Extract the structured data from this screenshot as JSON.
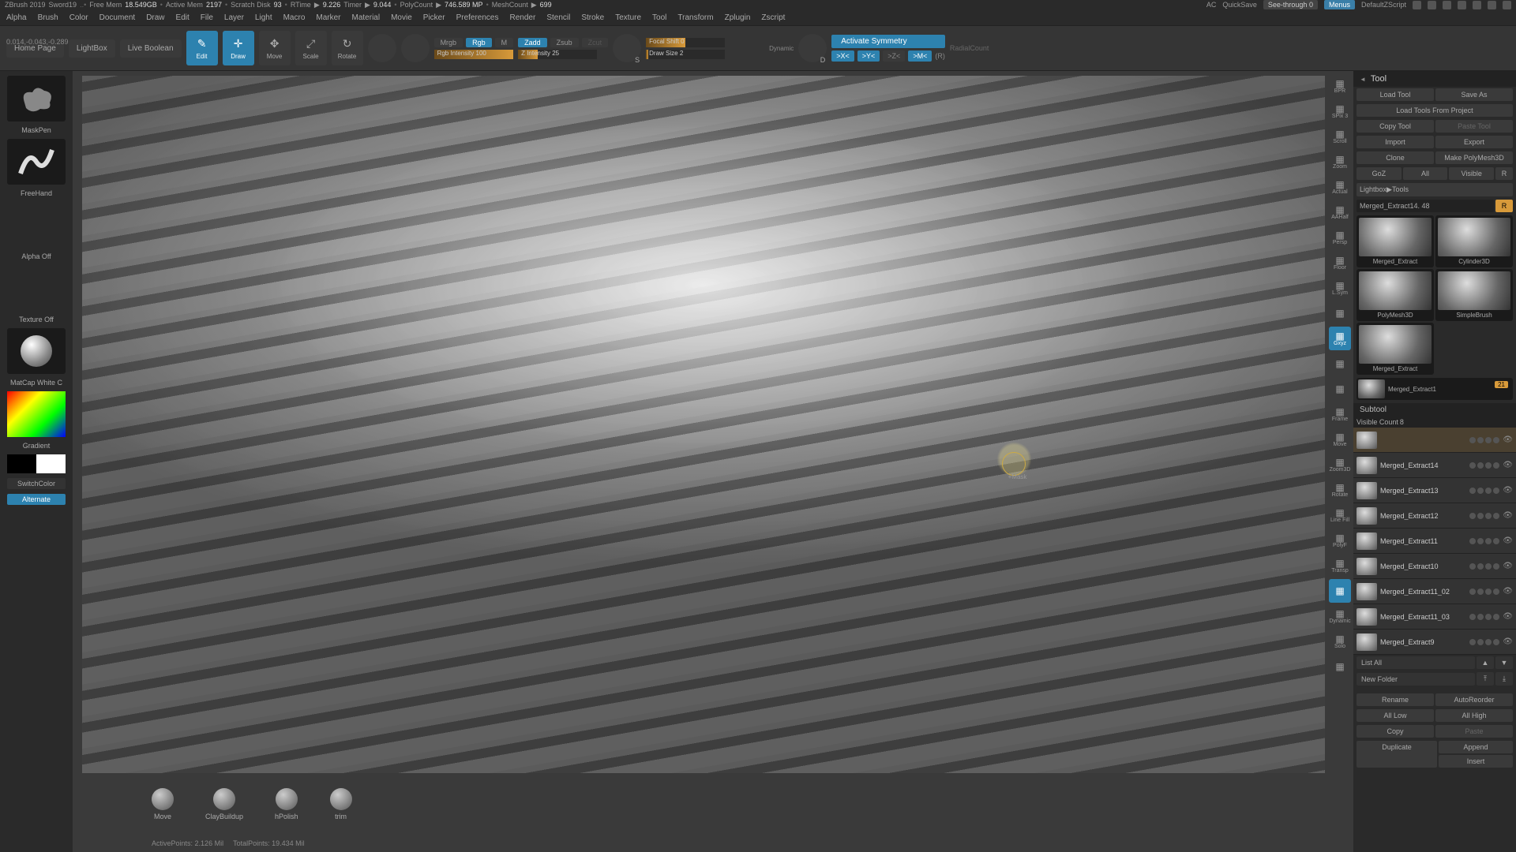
{
  "titlebar": {
    "app": "ZBrush 2019",
    "file": "Sword19",
    "freemem_label": "Free Mem",
    "freemem": "18.549GB",
    "activemem_label": "Active Mem",
    "activemem": "2197",
    "scratch_label": "Scratch Disk",
    "scratch": "93",
    "rtime_label": "RTime",
    "rtime": "9.226",
    "timer_label": "Timer",
    "timer": "9.044",
    "polycount_label": "PolyCount",
    "polycount": "746.589 MP",
    "meshcount_label": "MeshCount",
    "meshcount": "699",
    "ac": "AC",
    "quicksave": "QuickSave",
    "seethrough_label": "See-through",
    "seethrough": "0",
    "menus": "Menus",
    "zscript": "DefaultZScript"
  },
  "menubar": [
    "Alpha",
    "Brush",
    "Color",
    "Document",
    "Draw",
    "Edit",
    "File",
    "Layer",
    "Light",
    "Macro",
    "Marker",
    "Material",
    "Movie",
    "Picker",
    "Preferences",
    "Render",
    "Stencil",
    "Stroke",
    "Texture",
    "Tool",
    "Transform",
    "Zplugin",
    "Zscript"
  ],
  "coords": "0.014,-0.043,-0.289",
  "toolbar": {
    "home": "Home Page",
    "lightbox": "LightBox",
    "liveboolean": "Live Boolean",
    "edit": "Edit",
    "draw": "Draw",
    "move": "Move",
    "scale": "Scale",
    "rotate": "Rotate",
    "mrgb": "Mrgb",
    "rgb": "Rgb",
    "m": "M",
    "rgbintensity_label": "Rgb Intensity",
    "rgbintensity": "100",
    "zadd": "Zadd",
    "zsub": "Zsub",
    "zcut": "Zcut",
    "zintensity_label": "Z Intensity",
    "zintensity": "25",
    "focalshift_label": "Focal Shift",
    "focalshift": "0",
    "drawsize_label": "Draw Size",
    "drawsize": "2",
    "dynamic": "Dynamic",
    "s": "S",
    "d": "D",
    "activate_symmetry": "Activate Symmetry",
    "radialcount": "RadialCount",
    "sym_x": ">X<",
    "sym_y": ">Y<",
    "sym_z": ">Z<",
    "sym_m": ">M<",
    "sym_r": "(R)"
  },
  "left": {
    "maskpen": "MaskPen",
    "freehand": "FreeHand",
    "alphaoff": "Alpha Off",
    "textureoff": "Texture Off",
    "matcap": "MatCap White C",
    "gradient": "Gradient",
    "switchcolor": "SwitchColor",
    "alternate": "Alternate"
  },
  "rightstrip": [
    {
      "l": "BPR",
      "a": false
    },
    {
      "l": "SPix 3",
      "a": false
    },
    {
      "l": "Scroll",
      "a": false
    },
    {
      "l": "Zoom",
      "a": false
    },
    {
      "l": "Actual",
      "a": false
    },
    {
      "l": "AAHalf",
      "a": false
    },
    {
      "l": "Persp",
      "a": false
    },
    {
      "l": "Floor",
      "a": false
    },
    {
      "l": "L.Sym",
      "a": false
    },
    {
      "l": "",
      "a": false
    },
    {
      "l": "Gxyz",
      "a": true
    },
    {
      "l": "",
      "a": false
    },
    {
      "l": "",
      "a": false
    },
    {
      "l": "Frame",
      "a": false
    },
    {
      "l": "Move",
      "a": false
    },
    {
      "l": "Zoom3D",
      "a": false
    },
    {
      "l": "Rotate",
      "a": false
    },
    {
      "l": "Line Fill",
      "a": false
    },
    {
      "l": "PolyF",
      "a": false
    },
    {
      "l": "Transp",
      "a": false
    },
    {
      "l": "",
      "a": true
    },
    {
      "l": "Dynamic",
      "a": false
    },
    {
      "l": "Solo",
      "a": false
    },
    {
      "l": "",
      "a": false
    }
  ],
  "bottom": [
    "Move",
    "ClayBuildup",
    "hPolish",
    "trim"
  ],
  "stats": {
    "active_label": "ActivePoints:",
    "active": "2.126 Mil",
    "total_label": "TotalPoints:",
    "total": "19.434 Mil"
  },
  "cursor_label": "+Mask",
  "tool": {
    "header": "Tool",
    "row1": [
      "Load Tool",
      "Save As"
    ],
    "row2": "Load Tools From Project",
    "row3": [
      "Copy Tool",
      "Paste Tool"
    ],
    "row4": [
      "Import",
      "Export"
    ],
    "row5": [
      "Clone",
      "Make PolyMesh3D"
    ],
    "row6": [
      "GoZ",
      "All",
      "Visible",
      "R"
    ],
    "lightbox": "Lightbox▶Tools",
    "current": "Merged_Extract14. 48",
    "r": "R",
    "cells": [
      "Merged_Extract",
      "Cylinder3D",
      "PolyMesh3D",
      "SimpleBrush",
      "Merged_Extract"
    ],
    "cellwide": "Merged_Extract1",
    "cellwide_badge": "21",
    "subtool": "Subtool",
    "visiblecount_label": "Visible Count",
    "visiblecount": "8",
    "items": [
      {
        "name": "",
        "active": true
      },
      {
        "name": "Merged_Extract14"
      },
      {
        "name": "Merged_Extract13"
      },
      {
        "name": "Merged_Extract12"
      },
      {
        "name": "Merged_Extract11"
      },
      {
        "name": "Merged_Extract10"
      },
      {
        "name": "Merged_Extract11_02"
      },
      {
        "name": "Merged_Extract11_03"
      },
      {
        "name": "Merged_Extract9"
      }
    ],
    "listall": "List All",
    "newfolder": "New Folder",
    "rename": "Rename",
    "autoreorder": "AutoReorder",
    "alllow": "All Low",
    "allhigh": "All High",
    "copy": "Copy",
    "paste": "Paste",
    "duplicate": "Duplicate",
    "append": "Append",
    "insert": "Insert"
  }
}
